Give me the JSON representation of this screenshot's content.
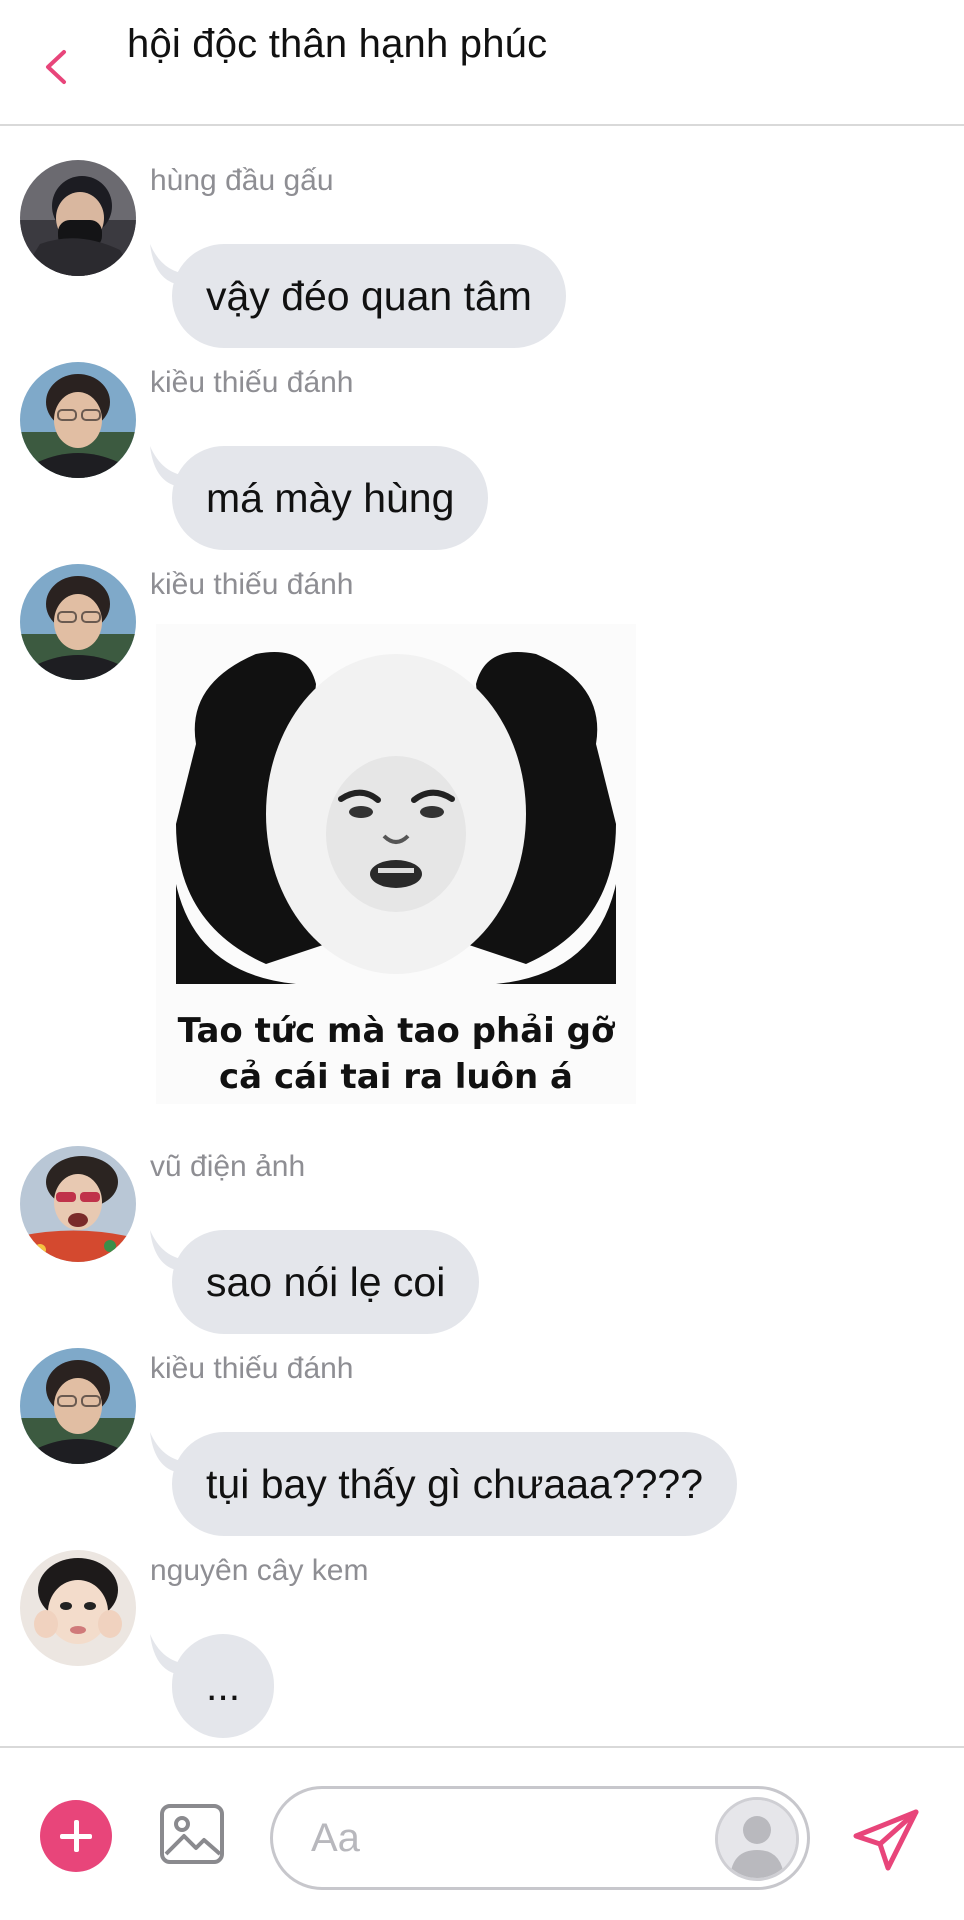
{
  "header": {
    "title": "hội độc thân hạnh phúc",
    "icon": "chevron-left-icon"
  },
  "messages": [
    {
      "sender": "hùng đầu gấu",
      "text": "vậy đéo quan tâm"
    },
    {
      "sender": "kiều thiếu đánh",
      "text": "má mày hùng"
    },
    {
      "sender": "kiều thiếu đánh",
      "sticker_caption_line1": "Tao tức mà tao phải gỡ",
      "sticker_caption_line2": "cả cái tai ra luôn á"
    },
    {
      "sender": "vũ điện ảnh",
      "text": "sao nói lẹ coi"
    },
    {
      "sender": "kiều thiếu đánh",
      "text": "tụi bay thấy gì chưaaa????"
    },
    {
      "sender": "nguyên cây kem",
      "text": "..."
    }
  ],
  "composer": {
    "placeholder": "Aa",
    "value": ""
  },
  "colors": {
    "accent": "#e8457a",
    "bubble": "#e4e6eb",
    "sender_text": "#8e8e93"
  }
}
